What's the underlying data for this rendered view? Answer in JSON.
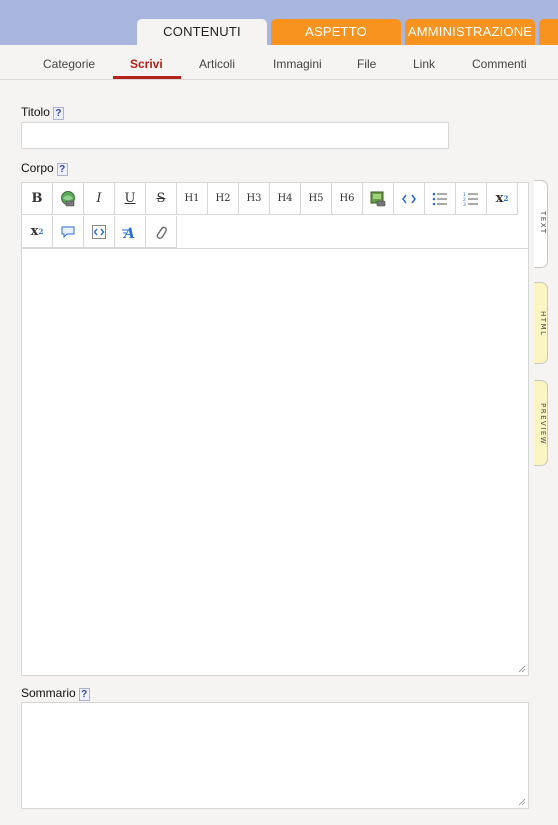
{
  "main_tabs": [
    {
      "label": "CONTENUTI",
      "active": true
    },
    {
      "label": "ASPETTO",
      "active": false
    },
    {
      "label": "AMMINISTRAZIONE",
      "active": false
    }
  ],
  "sub_nav": [
    {
      "label": "Categorie",
      "active": false
    },
    {
      "label": "Scrivi",
      "active": true
    },
    {
      "label": "Articoli",
      "active": false
    },
    {
      "label": "Immagini",
      "active": false
    },
    {
      "label": "File",
      "active": false
    },
    {
      "label": "Link",
      "active": false
    },
    {
      "label": "Commenti",
      "active": false
    }
  ],
  "form": {
    "title_label": "Titolo",
    "title_value": "",
    "body_label": "Corpo",
    "body_value": "",
    "summary_label": "Sommario",
    "summary_value": "",
    "help_glyph": "?"
  },
  "toolbar": {
    "bold": "B",
    "italic": "I",
    "underline": "U",
    "strike": "S",
    "h1": "H1",
    "h2": "H2",
    "h3": "H3",
    "h4": "H4",
    "h5": "H5",
    "h6": "H6",
    "sup_base": "x",
    "sup_exp": "2",
    "sub_base": "x",
    "sub_exp": "2"
  },
  "side_tabs": [
    {
      "label": "TEXT",
      "active": true
    },
    {
      "label": "HTML",
      "active": false
    },
    {
      "label": "PREVIEW",
      "active": false
    }
  ],
  "colors": {
    "header_bg": "#a9b6dd",
    "tab_orange": "#f7931e",
    "active_sub": "#b3211b",
    "side_tab_inactive": "#fbf5c4"
  }
}
